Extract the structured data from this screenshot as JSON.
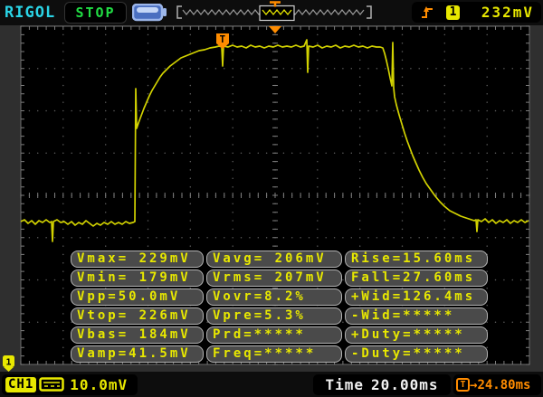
{
  "top_bar": {
    "logo": "RIGOL",
    "run_state": "STOP",
    "hpos_trigger_marker": "T",
    "trigger": {
      "channel": "1",
      "level": "232mV"
    }
  },
  "screen": {
    "trigger_badge": "T",
    "channel_marker": "1"
  },
  "measurements": {
    "col1": [
      "Vmax= 229mV",
      "Vmin= 179mV",
      "Vpp=50.0mV",
      "Vtop= 226mV",
      "Vbas= 184mV",
      "Vamp=41.5mV"
    ],
    "col2": [
      "Vavg= 206mV",
      "Vrms= 207mV",
      "Vovr=8.2%",
      "Vpre=5.3%",
      "Prd=*****",
      "Freq=*****"
    ],
    "col3": [
      "Rise=15.60ms",
      "Fall=27.60ms",
      "+Wid=126.4ms",
      "-Wid=*****",
      "+Duty=*****",
      "-Duty=*****"
    ]
  },
  "bottom_bar": {
    "channel": "CH1",
    "scale": "10.0mV",
    "time_label": "Time",
    "time_value": "20.00ms",
    "trig_offset_t": "T",
    "trig_offset_arrow": "→",
    "trig_offset_value": "24.80ms"
  },
  "colors": {
    "waveform": "#d2d200",
    "yellow": "#e8e800",
    "orange": "#ff8c00",
    "cyan": "#2ad4e6",
    "green": "#21dd44",
    "white": "#f0f0f0",
    "battery_outline": "#9cb6ea",
    "battery_fill": "#4a6fc0"
  },
  "waveform": {
    "points": [
      [
        23,
        245
      ],
      [
        27,
        243
      ],
      [
        31,
        247
      ],
      [
        35,
        244
      ],
      [
        39,
        248
      ],
      [
        43,
        244
      ],
      [
        47,
        246
      ],
      [
        51,
        243
      ],
      [
        55,
        246
      ],
      [
        57,
        245
      ],
      [
        58,
        267
      ],
      [
        59,
        245
      ],
      [
        63,
        243
      ],
      [
        67,
        246
      ],
      [
        71,
        245
      ],
      [
        75,
        248
      ],
      [
        79,
        245
      ],
      [
        83,
        249
      ],
      [
        87,
        246
      ],
      [
        91,
        248
      ],
      [
        95,
        244
      ],
      [
        99,
        247
      ],
      [
        103,
        250
      ],
      [
        107,
        247
      ],
      [
        111,
        249
      ],
      [
        115,
        246
      ],
      [
        119,
        248
      ],
      [
        123,
        245
      ],
      [
        127,
        248
      ],
      [
        131,
        246
      ],
      [
        135,
        248
      ],
      [
        139,
        245
      ],
      [
        143,
        247
      ],
      [
        147,
        246
      ],
      [
        149,
        245
      ],
      [
        150,
        98
      ],
      [
        151,
        142
      ],
      [
        153,
        136
      ],
      [
        156,
        128
      ],
      [
        159,
        120
      ],
      [
        162,
        113
      ],
      [
        165,
        106
      ],
      [
        168,
        100
      ],
      [
        171,
        95
      ],
      [
        174,
        90
      ],
      [
        177,
        85
      ],
      [
        180,
        81
      ],
      [
        184,
        77
      ],
      [
        188,
        73
      ],
      [
        192,
        70
      ],
      [
        196,
        67
      ],
      [
        200,
        64
      ],
      [
        205,
        62
      ],
      [
        210,
        60
      ],
      [
        215,
        58
      ],
      [
        220,
        56
      ],
      [
        226,
        55
      ],
      [
        232,
        53
      ],
      [
        238,
        52
      ],
      [
        242,
        51
      ],
      [
        245,
        52
      ],
      [
        246,
        73
      ],
      [
        247,
        51
      ],
      [
        252,
        52
      ],
      [
        257,
        50
      ],
      [
        262,
        52
      ],
      [
        267,
        51
      ],
      [
        272,
        53
      ],
      [
        277,
        50
      ],
      [
        282,
        52
      ],
      [
        287,
        51
      ],
      [
        292,
        53
      ],
      [
        297,
        51
      ],
      [
        302,
        52
      ],
      [
        307,
        50
      ],
      [
        312,
        52
      ],
      [
        317,
        51
      ],
      [
        322,
        52
      ],
      [
        327,
        50
      ],
      [
        332,
        52
      ],
      [
        336,
        51
      ],
      [
        339,
        44
      ],
      [
        340,
        80
      ],
      [
        341,
        51
      ],
      [
        346,
        52
      ],
      [
        351,
        50
      ],
      [
        356,
        53
      ],
      [
        361,
        51
      ],
      [
        366,
        52
      ],
      [
        371,
        50
      ],
      [
        376,
        53
      ],
      [
        381,
        51
      ],
      [
        386,
        52
      ],
      [
        391,
        50
      ],
      [
        396,
        52
      ],
      [
        401,
        51
      ],
      [
        406,
        53
      ],
      [
        411,
        51
      ],
      [
        416,
        52
      ],
      [
        420,
        52
      ],
      [
        423,
        53
      ],
      [
        425,
        59
      ],
      [
        427,
        67
      ],
      [
        429,
        76
      ],
      [
        431,
        86
      ],
      [
        433,
        95
      ],
      [
        434,
        47
      ],
      [
        435,
        97
      ],
      [
        436,
        107
      ],
      [
        438,
        116
      ],
      [
        441,
        127
      ],
      [
        444,
        137
      ],
      [
        447,
        147
      ],
      [
        450,
        156
      ],
      [
        453,
        164
      ],
      [
        456,
        172
      ],
      [
        459,
        179
      ],
      [
        463,
        188
      ],
      [
        467,
        196
      ],
      [
        471,
        203
      ],
      [
        476,
        210
      ],
      [
        481,
        217
      ],
      [
        486,
        223
      ],
      [
        491,
        228
      ],
      [
        497,
        233
      ],
      [
        503,
        236
      ],
      [
        509,
        239
      ],
      [
        515,
        241
      ],
      [
        521,
        243
      ],
      [
        524,
        244
      ],
      [
        526,
        243
      ],
      [
        527,
        256
      ],
      [
        528,
        243
      ],
      [
        532,
        245
      ],
      [
        536,
        242
      ],
      [
        540,
        246
      ],
      [
        544,
        243
      ],
      [
        548,
        247
      ],
      [
        552,
        244
      ],
      [
        556,
        246
      ],
      [
        560,
        243
      ],
      [
        564,
        247
      ],
      [
        568,
        244
      ],
      [
        572,
        246
      ],
      [
        576,
        243
      ],
      [
        580,
        246
      ],
      [
        584,
        244
      ]
    ]
  }
}
